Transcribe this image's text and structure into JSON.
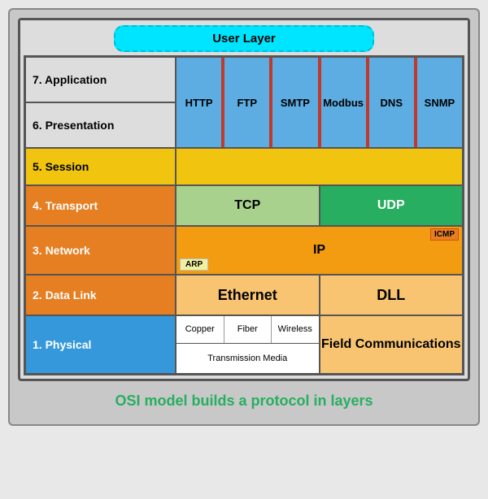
{
  "diagram": {
    "title": "OSI model builds a protocol in layers",
    "user_layer": "User Layer",
    "layers": [
      {
        "number": 7,
        "name": "Application",
        "label": "7. Application"
      },
      {
        "number": 6,
        "name": "Presentation",
        "label": "6. Presentation"
      },
      {
        "number": 5,
        "name": "Session",
        "label": "5. Session"
      },
      {
        "number": 4,
        "name": "Transport",
        "label": "4. Transport"
      },
      {
        "number": 3,
        "name": "Network",
        "label": "3. Network"
      },
      {
        "number": 2,
        "name": "Data Link",
        "label": "2. Data Link"
      },
      {
        "number": 1,
        "name": "Physical",
        "label": "1. Physical"
      }
    ],
    "protocols": {
      "app_pres": [
        "HTTP",
        "FTP",
        "SMTP",
        "Modbus",
        "DNS",
        "SNMP"
      ],
      "transport": {
        "left": "TCP",
        "right": "UDP"
      },
      "network": {
        "main": "IP",
        "badge1": "ICMP",
        "badge2": "ARP"
      },
      "datalink": {
        "left": "Ethernet",
        "right": "DLL"
      },
      "physical": {
        "media": [
          "Copper",
          "Fiber",
          "Wireless"
        ],
        "transmission": "Transmission Media",
        "field": "Field Communications"
      }
    }
  }
}
